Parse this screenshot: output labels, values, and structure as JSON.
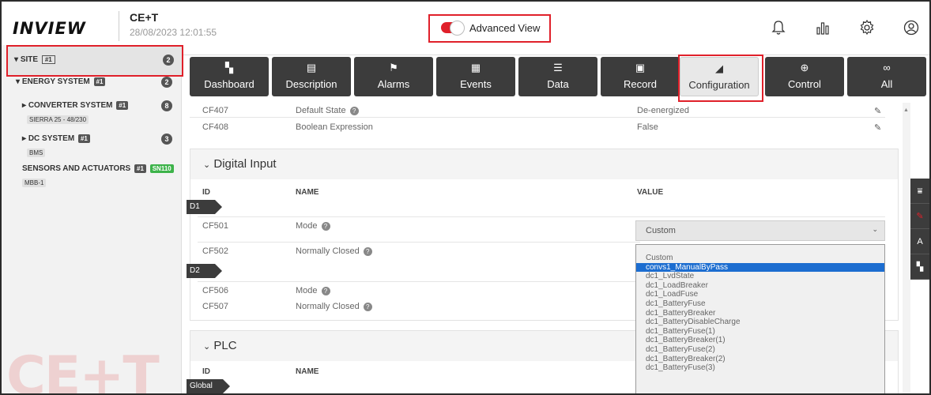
{
  "header": {
    "logo": "INVIEW",
    "brand": "CE+T",
    "datetime": "28/08/2023 12:01:55",
    "advanced_view_label": "Advanced View",
    "icons": [
      "bell-icon",
      "bar-chart-icon",
      "gear-icon",
      "user-icon"
    ]
  },
  "sidebar": {
    "site": {
      "label": "SITE",
      "tag": "#1",
      "count": "2"
    },
    "energy": {
      "label": "ENERGY SYSTEM",
      "tag": "#1",
      "count": "2"
    },
    "converter": {
      "label": "CONVERTER SYSTEM",
      "tag": "#1",
      "sub": "SIERRA 25 - 48/230",
      "count": "8"
    },
    "dc": {
      "label": "DC SYSTEM",
      "tag": "#1",
      "sub": "BMS",
      "count": "3"
    },
    "sensors": {
      "label": "SENSORS AND ACTUATORS",
      "tag": "#1",
      "tag2": "SN110",
      "sub": "MBB-1"
    }
  },
  "nav": [
    {
      "label": "Dashboard",
      "icon": "dashboard-icon"
    },
    {
      "label": "Description",
      "icon": "document-icon"
    },
    {
      "label": "Alarms",
      "icon": "alarm-icon"
    },
    {
      "label": "Events",
      "icon": "calendar-icon"
    },
    {
      "label": "Data",
      "icon": "list-icon"
    },
    {
      "label": "Record",
      "icon": "record-icon"
    },
    {
      "label": "Configuration",
      "icon": "configuration-icon"
    },
    {
      "label": "Control",
      "icon": "control-icon"
    },
    {
      "label": "All",
      "icon": "infinity-icon"
    }
  ],
  "top_rows": [
    {
      "id": "CF407",
      "name": "Default State",
      "value": "De-energized"
    },
    {
      "id": "CF408",
      "name": "Boolean Expression",
      "value": "False"
    }
  ],
  "digital_input": {
    "title": "Digital Input",
    "col_id": "ID",
    "col_name": "NAME",
    "col_value": "VALUE",
    "flag1": "D1",
    "flag2": "D2",
    "rows": [
      {
        "id": "CF501",
        "name": "Mode"
      },
      {
        "id": "CF502",
        "name": "Normally Closed"
      },
      {
        "id": "CF506",
        "name": "Mode"
      },
      {
        "id": "CF507",
        "name": "Normally Closed"
      }
    ],
    "select_value": "Custom"
  },
  "plc": {
    "title": "PLC",
    "col_id": "ID",
    "col_name": "NAME",
    "flag": "Global"
  },
  "dropdown_options": [
    "Custom",
    "convs1_ManualByPass",
    "dc1_LvdState",
    "dc1_LoadBreaker",
    "dc1_LoadFuse",
    "dc1_BatteryFuse",
    "dc1_BatteryBreaker",
    "dc1_BatteryDisableCharge",
    "dc1_BatteryFuse(1)",
    "dc1_BatteryBreaker(1)",
    "dc1_BatteryFuse(2)",
    "dc1_BatteryBreaker(2)",
    "dc1_BatteryFuse(3)"
  ],
  "dropdown_selected_index": 1,
  "watermark": "CE+T",
  "colors": {
    "accent": "#e0202a",
    "nav_bg": "#3c3c3c",
    "selected_option": "#1c6dd0"
  }
}
